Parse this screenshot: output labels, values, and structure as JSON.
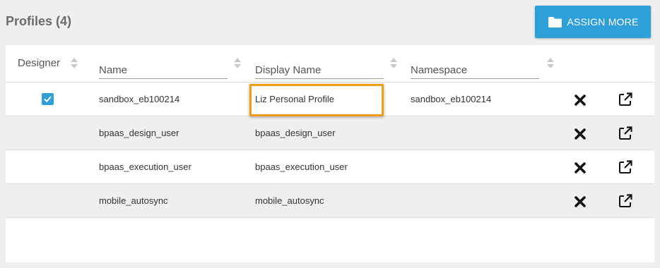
{
  "header": {
    "title": "Profiles (4)",
    "assign_button_label": "ASSIGN MORE",
    "assign_button_icon": "folder-icon"
  },
  "table": {
    "columns": {
      "designer": "Designer",
      "name": "Name",
      "display_name": "Display Name",
      "namespace": "Namespace"
    },
    "rows": [
      {
        "designer": true,
        "name": "sandbox_eb100214",
        "display_name": "Liz Personal Profile",
        "namespace": "sandbox_eb100214",
        "highlighted": true
      },
      {
        "designer": false,
        "name": "bpaas_design_user",
        "display_name": "bpaas_design_user",
        "namespace": ""
      },
      {
        "designer": false,
        "name": "bpaas_execution_user",
        "display_name": "bpaas_execution_user",
        "namespace": ""
      },
      {
        "designer": false,
        "name": "mobile_autosync",
        "display_name": "mobile_autosync",
        "namespace": ""
      }
    ],
    "row_actions": [
      "delete-icon",
      "external-link-icon"
    ]
  },
  "colors": {
    "accent": "#2e9fd8",
    "highlight": "#f39c12",
    "alt_row": "#efefef"
  }
}
